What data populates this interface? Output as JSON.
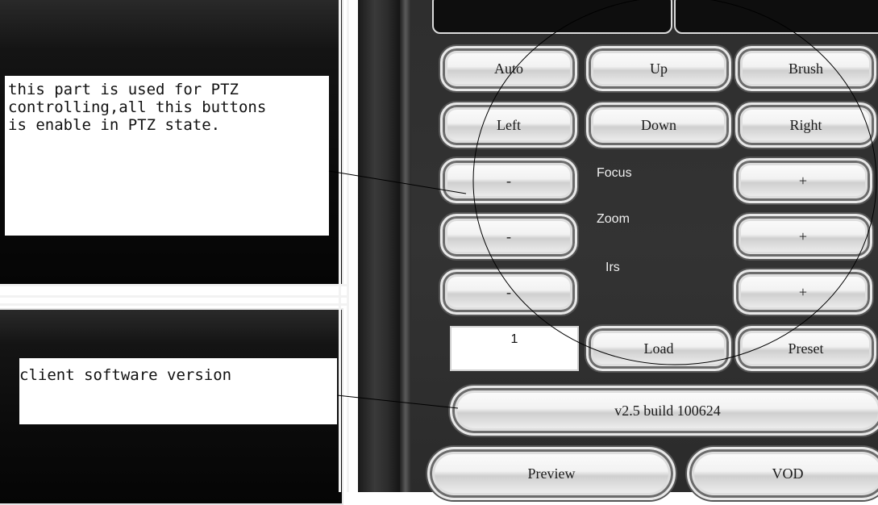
{
  "annotations": {
    "ptz_note": "this part is used for PTZ\ncontrolling,all this buttons\nis enable in PTZ state.",
    "version_note": "client software version"
  },
  "ptz": {
    "auto": "Auto",
    "up": "Up",
    "brush": "Brush",
    "left": "Left",
    "down": "Down",
    "right": "Right",
    "focus_label": "Focus",
    "zoom_label": "Zoom",
    "iris_label": "Irs",
    "minus": "-",
    "plus": "+"
  },
  "preset": {
    "number": "1",
    "load": "Load",
    "preset": "Preset"
  },
  "version": "v2.5 build 100624",
  "nav": {
    "preview": "Preview",
    "vod": "VOD"
  }
}
